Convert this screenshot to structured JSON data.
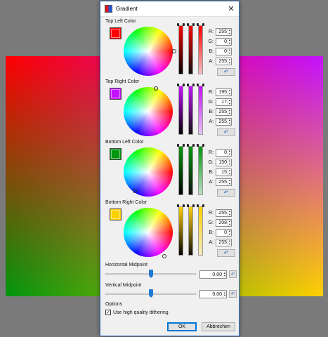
{
  "dialog": {
    "title": "Gradient",
    "close_glyph": "✕",
    "icon": "gradient-icon"
  },
  "sections": [
    {
      "label": "Top Left Color",
      "color": "#ff0000",
      "channels": [
        {
          "label": "R:",
          "value": "255"
        },
        {
          "label": "G:",
          "value": "0"
        },
        {
          "label": "B:",
          "value": "0"
        },
        {
          "label": "A:",
          "value": "255"
        }
      ]
    },
    {
      "label": "Top Right Color",
      "color": "#c311ff",
      "channels": [
        {
          "label": "R:",
          "value": "195"
        },
        {
          "label": "G:",
          "value": "17"
        },
        {
          "label": "B:",
          "value": "255"
        },
        {
          "label": "A:",
          "value": "255"
        }
      ]
    },
    {
      "label": "Bottom Left Color",
      "color": "#00960f",
      "channels": [
        {
          "label": "R:",
          "value": "0"
        },
        {
          "label": "G:",
          "value": "150"
        },
        {
          "label": "B:",
          "value": "15"
        },
        {
          "label": "A:",
          "value": "255"
        }
      ]
    },
    {
      "label": "Bottom Right Color",
      "color": "#ffd000",
      "channels": [
        {
          "label": "R:",
          "value": "255"
        },
        {
          "label": "G:",
          "value": "208"
        },
        {
          "label": "B:",
          "value": "0"
        },
        {
          "label": "A:",
          "value": "255"
        }
      ]
    }
  ],
  "horizontal_midpoint": {
    "label": "Horizontal Midpoint",
    "value": "0,00",
    "position": 0.5
  },
  "vertical_midpoint": {
    "label": "Vertical Midpoint",
    "value": "0,00",
    "position": 0.5
  },
  "options": {
    "label": "Options",
    "dithering_label": "Use high quality dithering",
    "dithering_checked": true,
    "check_glyph": "✓"
  },
  "buttons": {
    "ok": "OK",
    "cancel": "Abbrechen"
  },
  "glyphs": {
    "reset": "↶",
    "spin_up": "▲",
    "spin_down": "▼"
  },
  "colors": {
    "accent": "#0078d7",
    "dialog_bg": "#f0f0f0",
    "canvas_bg": "#7a7a7a"
  }
}
